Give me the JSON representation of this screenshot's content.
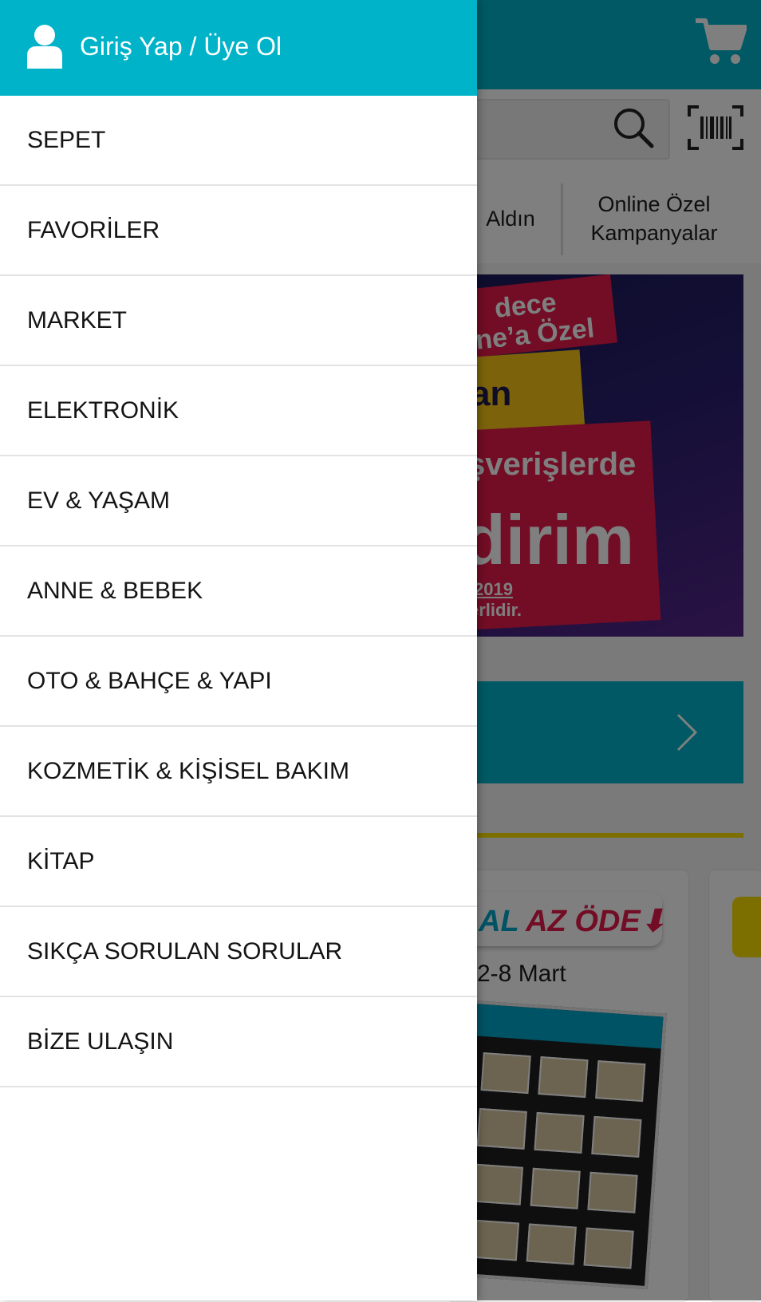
{
  "app": {
    "tabs": {
      "left": "Aldın",
      "right_line1": "Online Özel",
      "right_line2": "Kampanyalar"
    },
    "banner": {
      "line1": "dece",
      "line2": "ne’a Özel",
      "line3": "an",
      "line4": "şverişlerde",
      "line5": "dirim",
      "line6": "2019",
      "line7": "erlidir."
    },
    "promo": {
      "badge_part1": "AL",
      "badge_part2": "AZ ÖDE",
      "arrow": "⬇",
      "date": "2-8 Mart"
    },
    "colors": {
      "accent": "#00b3c9",
      "highlight": "#f8df00",
      "promo_red": "#e41a4b"
    }
  },
  "drawer": {
    "header": {
      "login_label": "Giriş Yap / Üye Ol",
      "icon": "user-icon"
    },
    "menu": [
      {
        "label": "SEPET"
      },
      {
        "label": "FAVORİLER"
      },
      {
        "label": "MARKET"
      },
      {
        "label": "ELEKTRONİK"
      },
      {
        "label": "EV & YAŞAM"
      },
      {
        "label": "ANNE & BEBEK"
      },
      {
        "label": "OTO & BAHÇE & YAPI"
      },
      {
        "label": "KOZMETİK & KİŞİSEL BAKIM"
      },
      {
        "label": "KİTAP"
      },
      {
        "label": "SIKÇA SORULAN SORULAR"
      },
      {
        "label": "BİZE ULAŞIN"
      }
    ]
  }
}
